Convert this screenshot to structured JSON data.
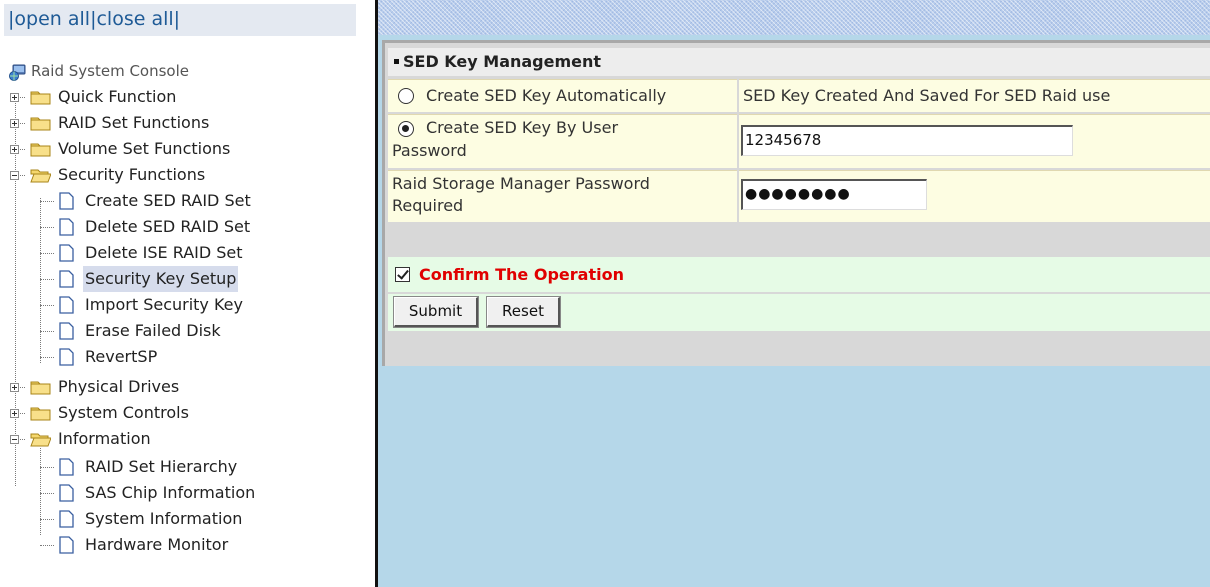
{
  "nav": {
    "open_all": "open all",
    "close_all": "close all",
    "sep": "|",
    "root": "Raid System Console",
    "quick_function": "Quick Function",
    "raid_set_functions": "RAID Set Functions",
    "volume_set_functions": "Volume Set Functions",
    "security_functions": "Security Functions",
    "security_items": [
      "Create SED RAID Set",
      "Delete SED RAID Set",
      "Delete ISE RAID Set",
      "Security Key Setup",
      "Import Security Key",
      "Erase Failed Disk",
      "RevertSP"
    ],
    "physical_drives": "Physical Drives",
    "system_controls": "System Controls",
    "information": "Information",
    "information_items": [
      "RAID Set Hierarchy",
      "SAS Chip Information",
      "System Information",
      "Hardware Monitor"
    ],
    "selected_item": "Security Key Setup"
  },
  "form": {
    "title": "SED Key Management",
    "option_auto_label": "Create SED Key Automatically",
    "option_auto_desc": "SED Key Created And Saved For SED Raid use",
    "option_user_label_line1": "Create SED Key By User",
    "option_user_label_line2": "Password",
    "user_password_value": "12345678",
    "rsm_password_label_line1": "Raid Storage Manager Password",
    "rsm_password_label_line2": "Required",
    "rsm_password_value": "●●●●●●●●",
    "selected_option": "user_password",
    "confirm_label": "Confirm The Operation",
    "confirm_checked": true,
    "submit_label": "Submit",
    "reset_label": "Reset"
  },
  "colors": {
    "link": "#1e5a96",
    "confirm_text": "#e00000",
    "right_background": "#b5d7e9",
    "form_row_yellow": "#fdfde2",
    "form_row_green": "#e6fbe6"
  },
  "icons": {
    "root": "server-globe-icon",
    "folder_closed": "folder-closed-icon",
    "folder_open": "folder-open-icon",
    "page": "page-icon",
    "expand": "plus-box-icon",
    "collapse": "minus-box-icon",
    "radio_on": "radio-selected-icon",
    "radio_off": "radio-unselected-icon",
    "checkbox": "checkbox-checked-icon"
  }
}
